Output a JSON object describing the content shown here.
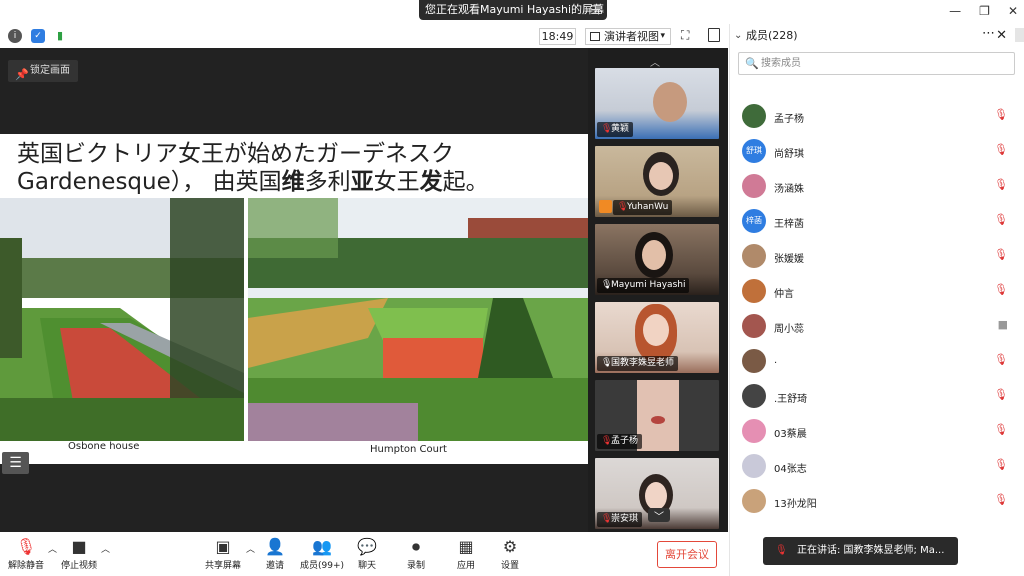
{
  "topbar": {
    "share_banner": "您正在观看Mayumi Hayashi的屏幕",
    "banner_menu_icon": "menu-icon",
    "window_controls": [
      "—",
      "❐",
      "✕"
    ]
  },
  "toolrow": {
    "icons": [
      "info-icon",
      "shield-icon",
      "signal-icon"
    ],
    "time": "18:49",
    "view_label": "演讲者视图",
    "view_caret": "▾"
  },
  "share": {
    "pin_label": "锁定画面",
    "slide_line1": "英国ビクトリア女王が始めたガーデネスク",
    "slide_line2_parts": [
      "Gardenesque）， 由英国",
      "维",
      "多利",
      "亚",
      "女王",
      "发",
      "起。"
    ],
    "caption_left": "Osbone house",
    "caption_right": "Humpton Court"
  },
  "strip": {
    "tiles": [
      {
        "name": "黄颖",
        "muted": true,
        "colors": [
          "#d8dde5",
          "#3b6fb5"
        ]
      },
      {
        "name": "YuhanWu",
        "muted": true,
        "colors": [
          "#c9b89c",
          "#6b5a45"
        ]
      },
      {
        "name": "Mayumi Hayashi",
        "muted": false,
        "colors": [
          "#8a7462",
          "#2a211c"
        ]
      },
      {
        "name": "国教李姝昱老师",
        "muted": false,
        "colors": [
          "#e9d9cf",
          "#9a6e5c"
        ]
      },
      {
        "name": "孟子杨",
        "muted": true,
        "colors": [
          "#3a3a3a",
          "#d9b6a6"
        ]
      },
      {
        "name": "崇安琪",
        "muted": true,
        "colors": [
          "#dcd8d6",
          "#4a3a35"
        ]
      }
    ]
  },
  "bottombar": {
    "unmute": "解除静音",
    "stop_video": "停止视频",
    "share_screen": "共享屏幕",
    "invite": "邀请",
    "participants": "成员(99+)",
    "chat": "聊天",
    "record": "录制",
    "apps": "应用",
    "settings": "设置",
    "leave": "离开会议"
  },
  "panel": {
    "title": "成员(228)",
    "search_placeholder": "搜索成员",
    "members": [
      {
        "name": "孟子杨",
        "avatar": "photo",
        "color": "#3f6b3a",
        "muted": true
      },
      {
        "name": "尚舒琪",
        "avatar": "舒琪",
        "color": "#2f7de1",
        "muted": true
      },
      {
        "name": "汤涵姝",
        "avatar": "photo",
        "color": "#d07a96",
        "muted": true
      },
      {
        "name": "王梓菡",
        "avatar": "梓菡",
        "color": "#2f7de1",
        "muted": true
      },
      {
        "name": "张媛媛",
        "avatar": "photo",
        "color": "#b08a6a",
        "muted": true
      },
      {
        "name": "仲言",
        "avatar": "photo",
        "color": "#c0703a",
        "muted": true
      },
      {
        "name": "周小蕊",
        "avatar": "photo",
        "color": "#a3564f",
        "muted": false
      },
      {
        "name": ".",
        "avatar": "photo",
        "color": "#7a5a45",
        "muted": true
      },
      {
        "name": ".王舒琦",
        "avatar": "photo",
        "color": "#444444",
        "muted": true
      },
      {
        "name": "03蔡晨",
        "avatar": "photo",
        "color": "#e58fb3",
        "muted": true
      },
      {
        "name": "04张志",
        "avatar": "photo",
        "color": "#c9c9d9",
        "muted": true
      },
      {
        "name": "13孙龙阳",
        "avatar": "photo",
        "color": "#c9a27a",
        "muted": true
      }
    ],
    "speaking": "正在讲话: 国教李姝昱老师; Ma..."
  },
  "colors": {
    "accent": "#2f7de1",
    "danger": "#e3483a",
    "dark_bg": "#222222"
  }
}
